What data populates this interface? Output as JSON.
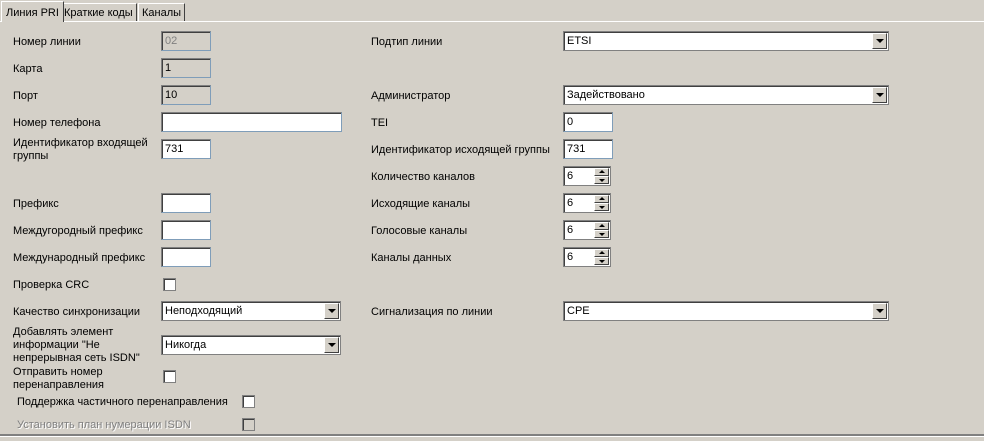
{
  "tabs": [
    {
      "label": "Линия PRI",
      "active": true
    },
    {
      "label": "Краткие коды",
      "active": false
    },
    {
      "label": "Каналы",
      "active": false
    }
  ],
  "left": {
    "line_number": {
      "label": "Номер линии",
      "value": "02"
    },
    "card": {
      "label": "Карта",
      "value": "1"
    },
    "port": {
      "label": "Порт",
      "value": "10"
    },
    "phone": {
      "label": "Номер телефона",
      "value": ""
    },
    "incoming_group": {
      "label": "Идентификатор входящей группы",
      "value": "731"
    },
    "prefix": {
      "label": "Префикс",
      "value": ""
    },
    "national_prefix": {
      "label": "Междугородный префикс",
      "value": ""
    },
    "international_prefix": {
      "label": "Международный префикс",
      "value": ""
    },
    "crc_check": {
      "label": "Проверка CRC",
      "checked": false
    },
    "sync_quality": {
      "label": "Качество синхронизации",
      "value": "Неподходящий"
    },
    "add_element": {
      "label": "Добавлять элемент информации \"Не непрерывная сеть ISDN\"",
      "value": "Никогда"
    },
    "send_redirect": {
      "label": "Отправить номер перенаправления",
      "checked": false
    },
    "partial_redirect": {
      "label": "Поддержка частичного перенаправления",
      "checked": false
    },
    "isdn_numbering": {
      "label": "Установить план нумерации ISDN",
      "checked": false,
      "disabled": true
    }
  },
  "right": {
    "line_subtype": {
      "label": "Подтип линии",
      "value": "ETSI"
    },
    "admin": {
      "label": "Администратор",
      "value": "Задействовано"
    },
    "tei": {
      "label": "TEI",
      "value": "0"
    },
    "outgoing_group": {
      "label": "Идентификатор исходящей группы",
      "value": "731"
    },
    "channel_count": {
      "label": "Количество каналов",
      "value": "6"
    },
    "outgoing_channels": {
      "label": "Исходящие каналы",
      "value": "6"
    },
    "voice_channels": {
      "label": "Голосовые каналы",
      "value": "6"
    },
    "data_channels": {
      "label": "Каналы данных",
      "value": "6"
    },
    "line_signaling": {
      "label": "Сигнализация по линии",
      "value": "CPE"
    }
  },
  "colors": {
    "background": "#d4d0c8",
    "field": "#ffffff",
    "disabled_text": "#808080"
  }
}
